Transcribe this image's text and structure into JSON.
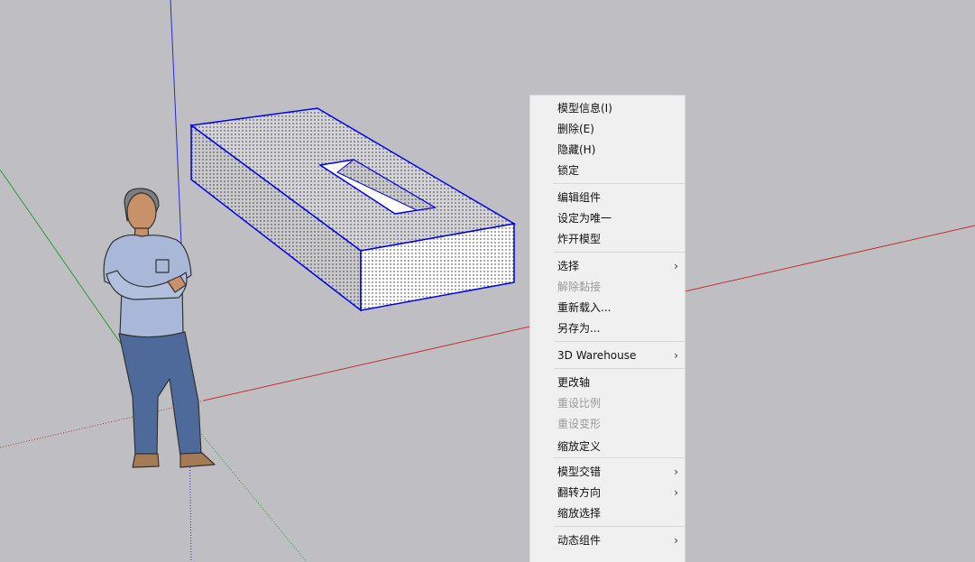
{
  "context_menu": {
    "items": [
      {
        "label": "模型信息(I)",
        "enabled": true,
        "submenu": false
      },
      {
        "label": "删除(E)",
        "enabled": true,
        "submenu": false
      },
      {
        "label": "隐藏(H)",
        "enabled": true,
        "submenu": false
      },
      {
        "label": "锁定",
        "enabled": true,
        "submenu": false
      },
      {
        "label": "编辑组件",
        "enabled": true,
        "submenu": false
      },
      {
        "label": "设定为唯一",
        "enabled": true,
        "submenu": false
      },
      {
        "label": "炸开模型",
        "enabled": true,
        "submenu": false
      },
      {
        "label": "选择",
        "enabled": true,
        "submenu": true
      },
      {
        "label": "解除黏接",
        "enabled": false,
        "submenu": false
      },
      {
        "label": "重新载入...",
        "enabled": true,
        "submenu": false
      },
      {
        "label": "另存为...",
        "enabled": true,
        "submenu": false
      },
      {
        "label": "3D Warehouse",
        "enabled": true,
        "submenu": true
      },
      {
        "label": "更改轴",
        "enabled": true,
        "submenu": false
      },
      {
        "label": "重设比例",
        "enabled": false,
        "submenu": false
      },
      {
        "label": "重设变形",
        "enabled": false,
        "submenu": false
      },
      {
        "label": "缩放定义",
        "enabled": true,
        "submenu": false
      },
      {
        "label": "模型交错",
        "enabled": true,
        "submenu": true
      },
      {
        "label": "翻转方向",
        "enabled": true,
        "submenu": true
      },
      {
        "label": "缩放选择",
        "enabled": true,
        "submenu": false
      },
      {
        "label": "动态组件",
        "enabled": true,
        "submenu": true
      }
    ],
    "submenu_arrow": "›"
  },
  "scene": {
    "background_color": "#bfbfc3",
    "selection_color": "#0000ee",
    "axis_colors": {
      "red": "#c03030",
      "green": "#2f9a2f",
      "blue": "#2828d8"
    },
    "objects": [
      "axis-lines",
      "selected-component-box-with-slot",
      "scale-figure-person"
    ]
  }
}
